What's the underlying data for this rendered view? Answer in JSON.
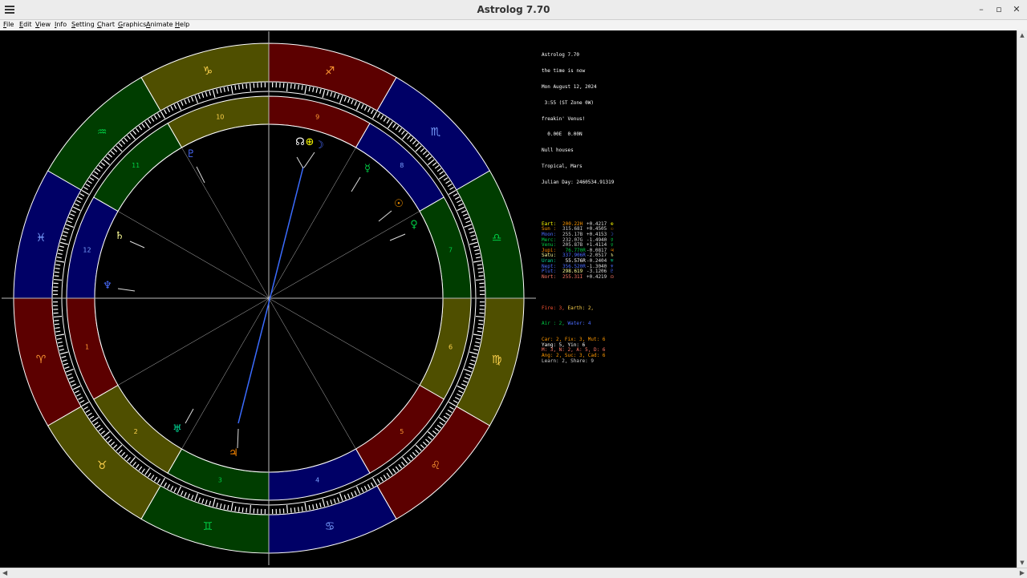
{
  "window": {
    "title": "Astrolog 7.70"
  },
  "menu": [
    "File",
    "Edit",
    "View",
    "Info",
    "Setting",
    "Chart",
    "Graphics",
    "Animate",
    "Help"
  ],
  "info": {
    "header": [
      "Astrolog 7.70",
      "the time is now",
      "Mon August 12, 2024",
      " 3:55 (ST Zone 0W)",
      "freakin' Venus!",
      "  0.00E  0.00N",
      "Null houses",
      "Tropical, Mars",
      "Julian Day: 2460534.91319"
    ],
    "planets": [
      {
        "name": "Eart:",
        "lon": "200.22H",
        "speed": "+0.4217",
        "glyph": "⊕",
        "color": "#ffff00",
        "lon_color": "#ff9900"
      },
      {
        "name": "Sun :",
        "lon": "315.68I",
        "speed": "+0.4505",
        "glyph": "☉",
        "color": "#ff9900",
        "lon_color": "#cccccc"
      },
      {
        "name": "Moon:",
        "lon": "255.17B",
        "speed": "+0.4153",
        "glyph": "☽",
        "color": "#4a6cff",
        "lon_color": "#cccccc"
      },
      {
        "name": "Merc:",
        "lon": "232.07G",
        "speed": "-1.4940",
        "glyph": "☿",
        "color": "#00cc44",
        "lon_color": "#cccccc"
      },
      {
        "name": "Venu:",
        "lon": "205.87B",
        "speed": "+1.4114",
        "glyph": "♀",
        "color": "#00cc44",
        "lon_color": "#cccccc"
      },
      {
        "name": "Jupi:",
        "lon": " 76.770R",
        "speed": "-0.0817",
        "glyph": "♃",
        "color": "#ff8800",
        "lon_color": "#00cc44"
      },
      {
        "name": "Satu:",
        "lon": "337.906R",
        "speed": "-2.0517",
        "glyph": "♄",
        "color": "#ffff99",
        "lon_color": "#4a6cff"
      },
      {
        "name": "Uran:",
        "lon": " 55.576R",
        "speed": "-0.2404",
        "glyph": "♅",
        "color": "#00dd99",
        "lon_color": "#ffffff"
      },
      {
        "name": "Nept:",
        "lon": "356.520R",
        "speed": "-1.3040",
        "glyph": "♆",
        "color": "#4a6cff",
        "lon_color": "#4a6cff"
      },
      {
        "name": "Plut:",
        "lon": "298.619",
        "speed": "-3.1206",
        "glyph": "♇",
        "color": "#4a6cff",
        "lon_color": "#ffff99"
      },
      {
        "name": "Nort:",
        "lon": "255.31I",
        "speed": "+0.4219",
        "glyph": "☊",
        "color": "#ff7766",
        "lon_color": "#ff7766"
      }
    ],
    "elements": {
      "fire": "Fire: 3,",
      "earth": "Earth: 2,",
      "air": "Air : 2,",
      "water": "Water: 4"
    },
    "stats": [
      {
        "text": "Car: 2, Fix: 3, Mut: 6",
        "color": "#ff9900"
      },
      {
        "text": "Yang: 5, Yin: 6",
        "color": "#ffffff"
      },
      {
        "text": "M: 3, N: 2, A: 5, D: 6",
        "color": "#ff7766"
      },
      {
        "text": "Ang: 2, Suc: 3, Cad: 6",
        "color": "#ff9900"
      },
      {
        "text": "Learn: 2, Share: 9",
        "color": "#cccccc"
      }
    ]
  },
  "chart": {
    "signs": [
      {
        "glyph": "♑",
        "color": "#ffd34d"
      },
      {
        "glyph": "♐",
        "color": "#ff9933"
      },
      {
        "glyph": "♏",
        "color": "#7aa0ff"
      },
      {
        "glyph": "♎",
        "color": "#00cc44"
      },
      {
        "glyph": "♍",
        "color": "#ffd34d"
      },
      {
        "glyph": "♌",
        "color": "#ff9933"
      },
      {
        "glyph": "♋",
        "color": "#7aa0ff"
      },
      {
        "glyph": "♊",
        "color": "#00cc44"
      },
      {
        "glyph": "♉",
        "color": "#ffd34d"
      },
      {
        "glyph": "♈",
        "color": "#ff9933"
      },
      {
        "glyph": "♓",
        "color": "#7aa0ff"
      },
      {
        "glyph": "♒",
        "color": "#00cc44"
      }
    ],
    "houses": [
      "10",
      "9",
      "8",
      "7",
      "6",
      "5",
      "4",
      "3",
      "2",
      "1",
      "12",
      "11"
    ],
    "planet_marks": [
      {
        "glyph": "☊",
        "color": "#ffffff"
      },
      {
        "glyph": "⊕",
        "color": "#ffff00"
      },
      {
        "glyph": "☽",
        "color": "#4a6cff"
      },
      {
        "glyph": "☿",
        "color": "#00cc44"
      },
      {
        "glyph": "☉",
        "color": "#ff9900"
      },
      {
        "glyph": "♀",
        "color": "#00cc44"
      },
      {
        "glyph": "♄",
        "color": "#ffff99"
      },
      {
        "glyph": "♆",
        "color": "#4a6cff"
      },
      {
        "glyph": "♇",
        "color": "#4a6cff"
      },
      {
        "glyph": "♅",
        "color": "#00dd99"
      },
      {
        "glyph": "♃",
        "color": "#ff8800"
      }
    ]
  }
}
